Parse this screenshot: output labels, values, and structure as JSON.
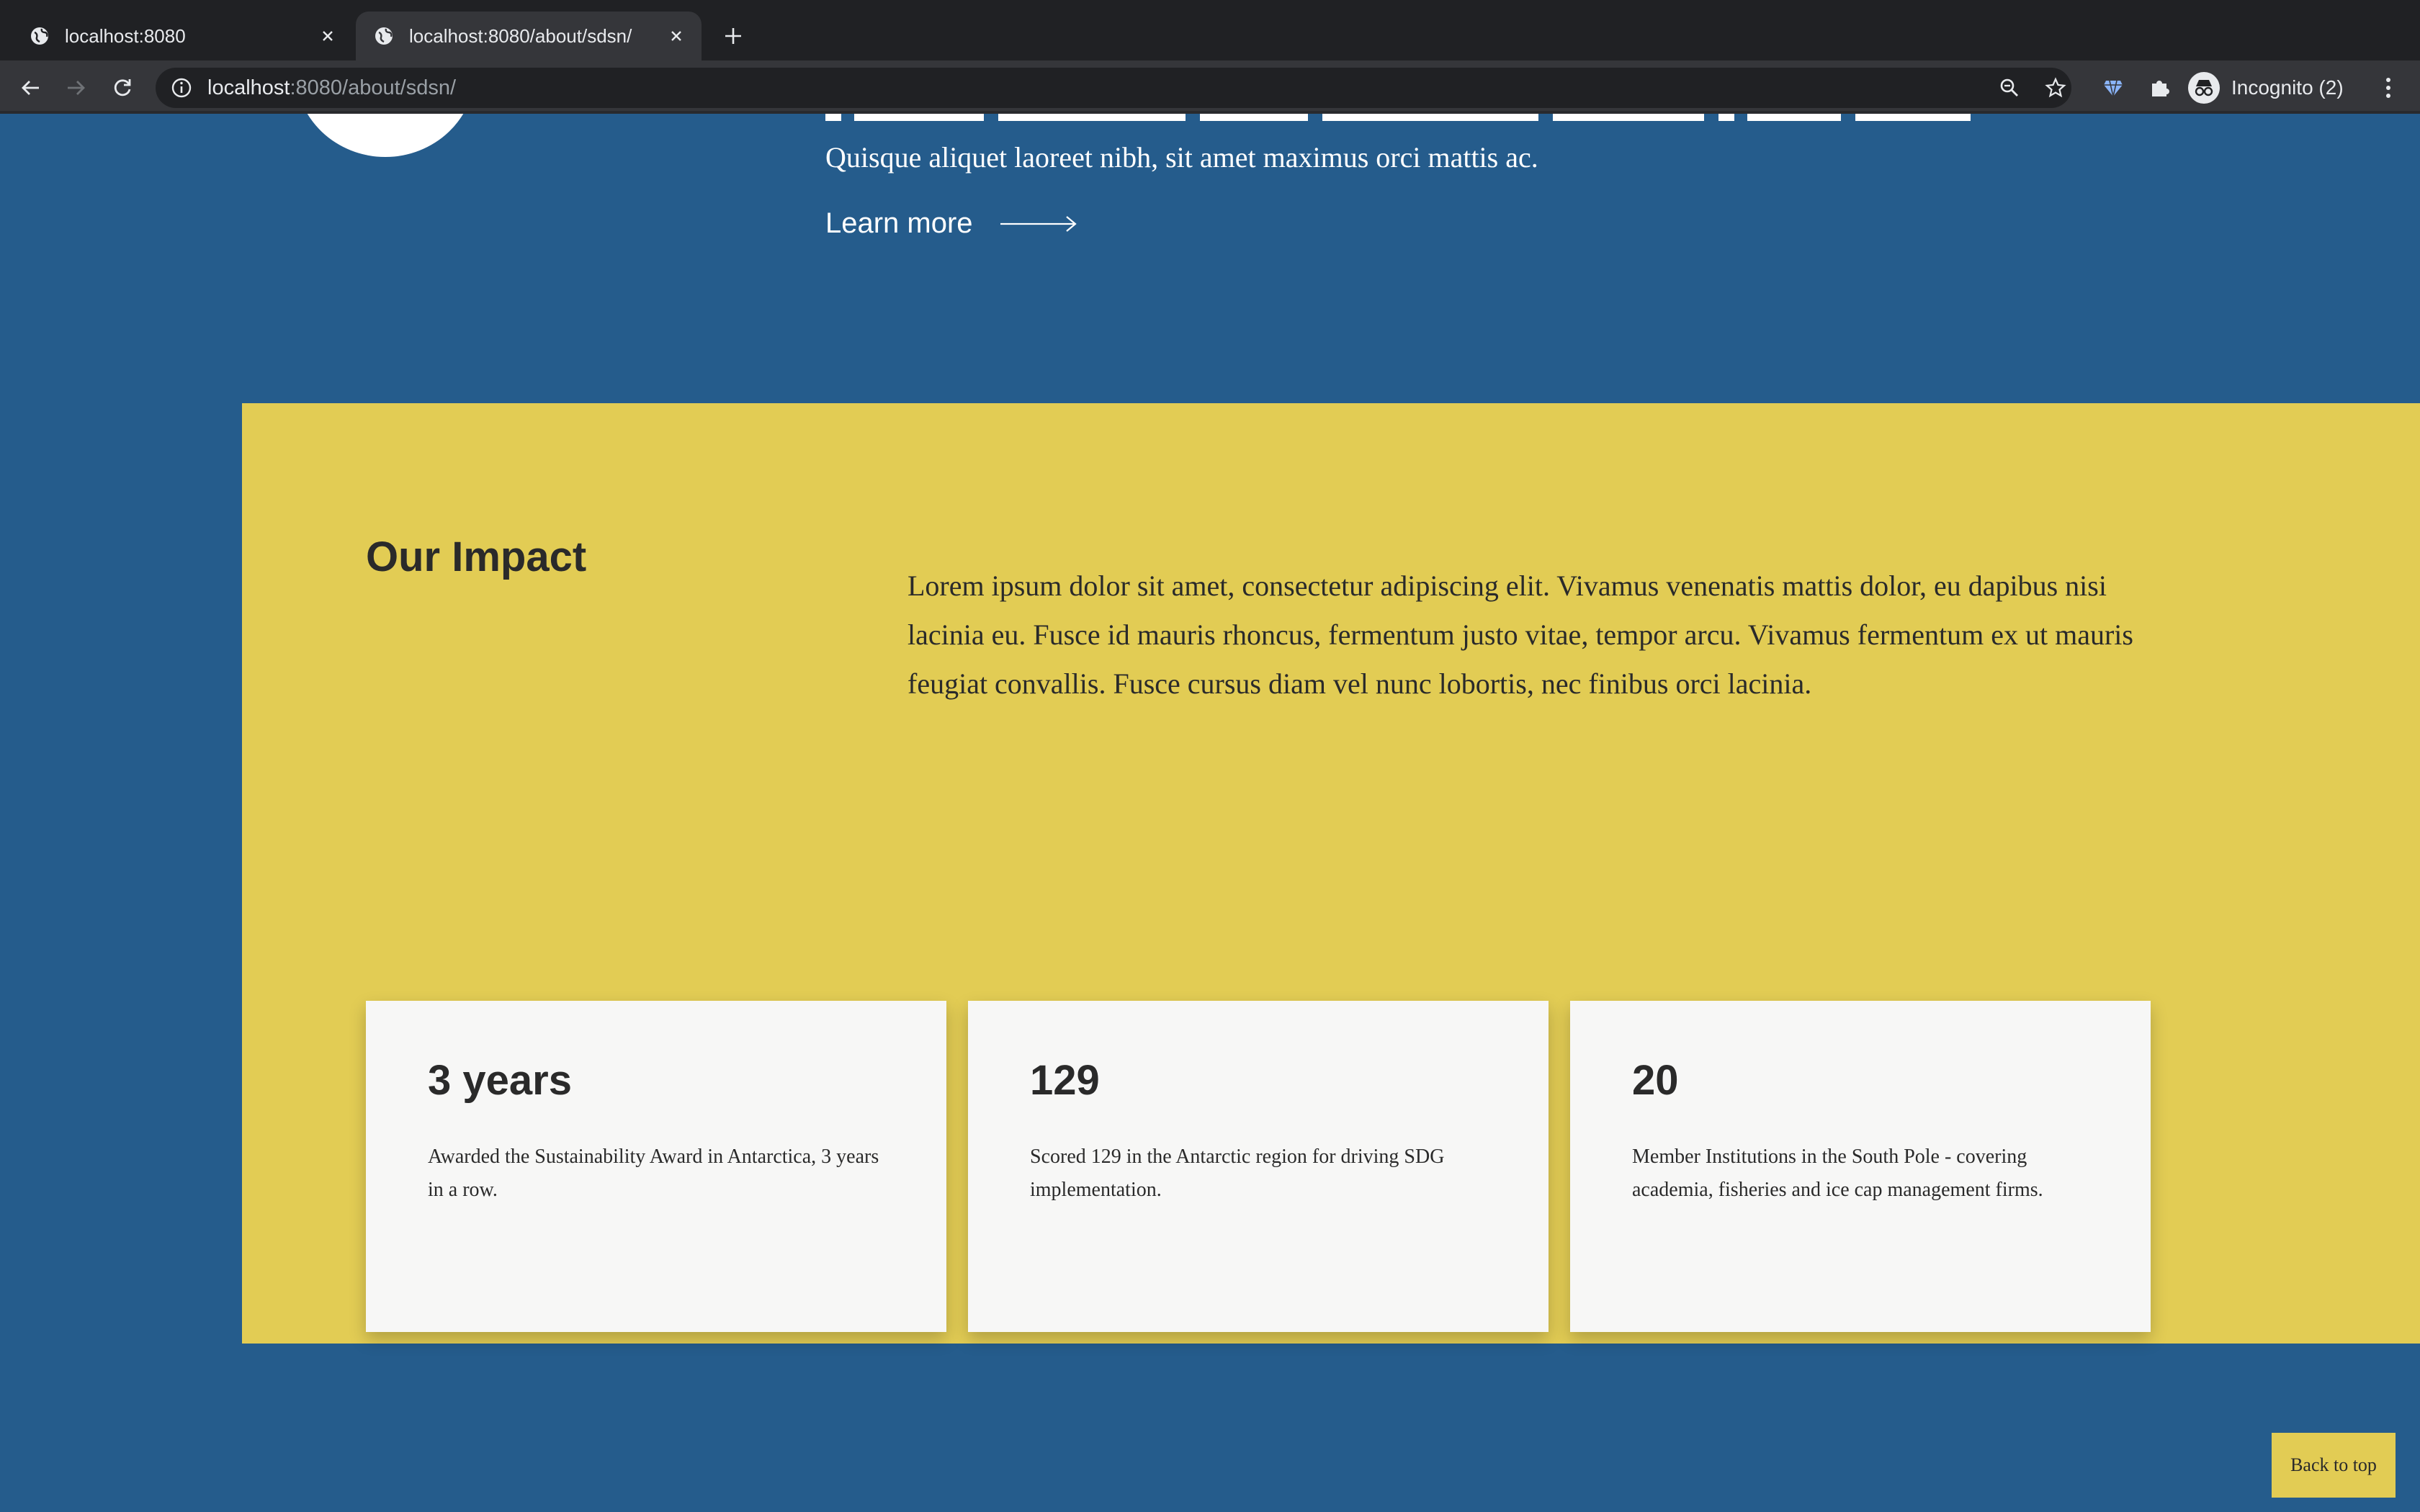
{
  "browser": {
    "tabs": [
      {
        "title": "localhost:8080",
        "active": false,
        "icon": "globe-icon"
      },
      {
        "title": "localhost:8080/about/sdsn/",
        "active": true,
        "icon": "globe-icon"
      }
    ],
    "url_host": "localhost",
    "url_rest": ":8080/about/sdsn/",
    "profile_label": "Incognito (2)",
    "colors": {
      "tabbar": "#202124",
      "toolbar": "#35363a",
      "omnibox": "#202124"
    }
  },
  "hero": {
    "intro_text": "Quisque aliquet laoreet nibh, sit amet maximus orci mattis ac.",
    "learn_more_label": "Learn more"
  },
  "impact": {
    "title": "Our Impact",
    "lead": "Lorem ipsum dolor sit amet, consectetur adipiscing elit. Vivamus venenatis mattis dolor, eu dapibus nisi lacinia eu. Fusce id mauris rhoncus, fermentum justo vitae, tempor arcu. Vivamus fermentum ex ut mauris feugiat convallis. Fusce cursus diam vel nunc lobortis, nec finibus orci lacinia.",
    "cards": [
      {
        "stat": "3 years",
        "description": "Awarded the Sustainability Award in Antarctica, 3 years in a row."
      },
      {
        "stat": "129",
        "description": "Scored 129 in the Antarctic region for driving SDG implementation."
      },
      {
        "stat": "20",
        "description": "Member Institutions in the South Pole - covering academia, fisheries and ice cap management firms."
      }
    ]
  },
  "back_to_top_label": "Back to top",
  "colors": {
    "page_background": "#255c8c",
    "impact_background": "#e2cc54",
    "card_background": "#f7f7f6",
    "text_dark": "#2a2a2a"
  }
}
